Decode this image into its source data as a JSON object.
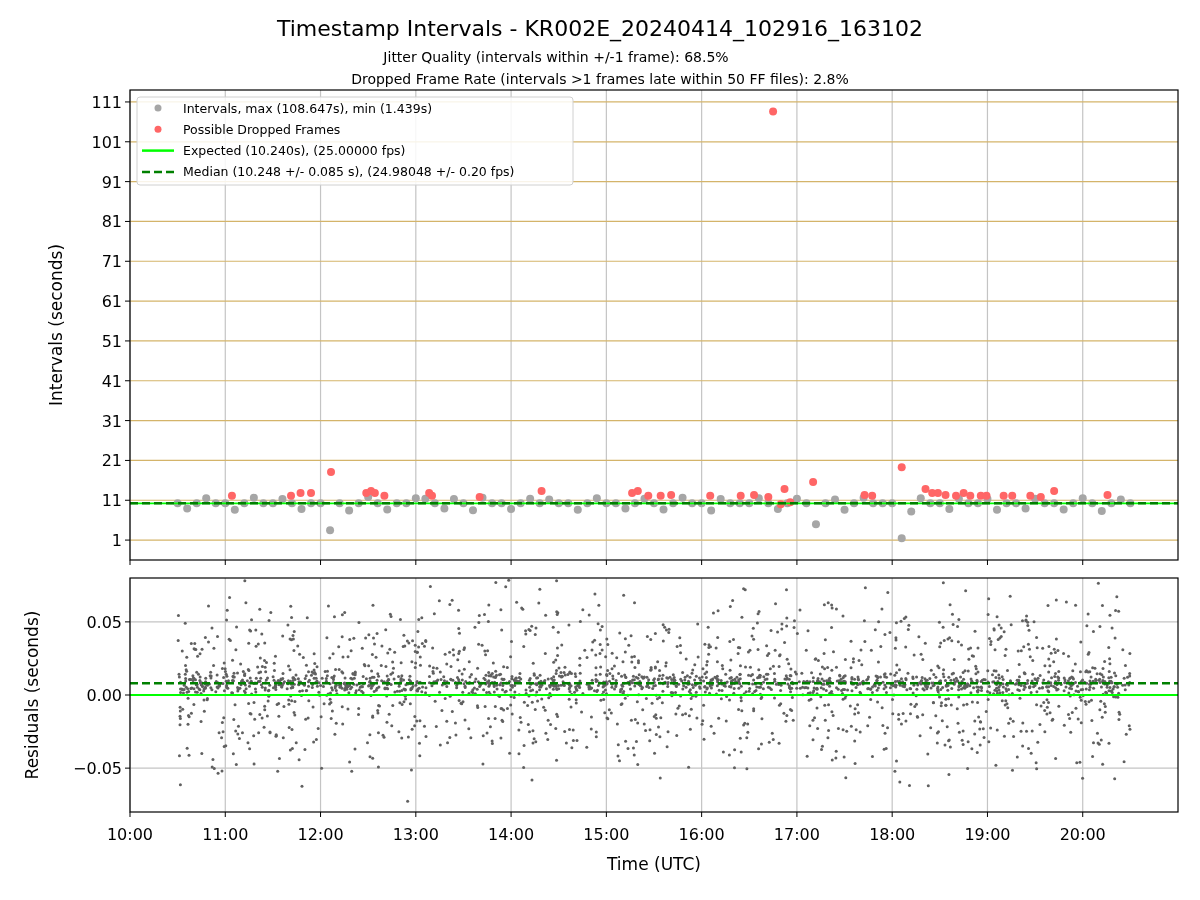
{
  "figure": {
    "title": "Timestamp Intervals - KR002E_20240414_102916_163102",
    "subtitles": [
      "Jitter Quality (intervals within +/-1 frame): 68.5%",
      "Dropped Frame Rate (intervals >1 frames late within 50 FF files): 2.8%"
    ]
  },
  "charts": [
    {
      "chart_data": {
        "type": "scatter",
        "ylabel": "Intervals (seconds)",
        "xlim": [
          10,
          21
        ],
        "ylim": [
          -4,
          114
        ],
        "yticks": [
          1,
          11,
          21,
          31,
          41,
          51,
          61,
          71,
          81,
          91,
          101,
          111
        ],
        "grid": true,
        "legend": "upper left",
        "series": [
          {
            "name": "Intervals, max (108.647s), min (1.439s)",
            "color": "#a6a6a6",
            "x": [
              10.5,
              10.6,
              10.7,
              10.8,
              10.9,
              11.0,
              11.1,
              11.2,
              11.3,
              11.4,
              11.5,
              11.6,
              11.7,
              11.8,
              11.9,
              12.0,
              12.1,
              12.2,
              12.3,
              12.4,
              12.5,
              12.6,
              12.7,
              12.8,
              12.9,
              13.0,
              13.1,
              13.2,
              13.3,
              13.4,
              13.5,
              13.6,
              13.7,
              13.8,
              13.9,
              14.0,
              14.1,
              14.2,
              14.3,
              14.4,
              14.5,
              14.6,
              14.7,
              14.8,
              14.9,
              15.0,
              15.1,
              15.2,
              15.3,
              15.4,
              15.5,
              15.6,
              15.7,
              15.8,
              15.9,
              16.0,
              16.1,
              16.2,
              16.3,
              16.4,
              16.5,
              16.6,
              16.7,
              16.8,
              16.9,
              17.0,
              17.1,
              17.2,
              17.3,
              17.4,
              17.5,
              17.6,
              17.7,
              17.8,
              17.9,
              18.0,
              18.1,
              18.2,
              18.3,
              18.4,
              18.5,
              18.6,
              18.7,
              18.8,
              18.9,
              19.0,
              19.1,
              19.2,
              19.3,
              19.4,
              19.5,
              19.6,
              19.7,
              19.8,
              19.9,
              20.0,
              20.1,
              20.2,
              20.3,
              20.4,
              20.5
            ],
            "values": [
              10.24,
              8.9,
              10.24,
              11.5,
              10.24,
              10.24,
              8.6,
              10.24,
              11.6,
              10.24,
              10.24,
              11.3,
              10.24,
              8.8,
              10.24,
              10.24,
              3.5,
              10.24,
              8.4,
              10.24,
              11.8,
              10.24,
              8.7,
              10.24,
              10.24,
              11.5,
              11.4,
              10.24,
              8.9,
              11.3,
              10.24,
              8.5,
              11.6,
              10.24,
              10.24,
              8.8,
              10.24,
              11.4,
              10.24,
              11.2,
              10.24,
              10.24,
              8.6,
              10.24,
              11.5,
              10.24,
              10.24,
              8.9,
              10.24,
              11.4,
              10.24,
              8.7,
              10.24,
              11.6,
              10.24,
              10.24,
              8.4,
              11.3,
              10.24,
              10.24,
              10.24,
              11.5,
              10.24,
              8.8,
              10.24,
              11.4,
              10.24,
              5.0,
              10.24,
              11.2,
              8.6,
              10.24,
              11.6,
              10.24,
              10.24,
              10.24,
              1.44,
              8.2,
              11.5,
              10.24,
              10.24,
              8.8,
              11.4,
              10.24,
              10.24,
              11.3,
              8.6,
              10.24,
              10.24,
              8.9,
              11.4,
              10.24,
              10.24,
              8.7,
              10.24,
              11.5,
              10.24,
              8.3,
              10.24,
              11.2,
              10.24
            ]
          },
          {
            "name": "Possible Dropped Frames",
            "color": "#ff6666",
            "x": [
              11.07,
              11.69,
              11.79,
              11.9,
              12.11,
              12.48,
              12.53,
              12.57,
              12.67,
              13.14,
              13.17,
              13.67,
              14.32,
              15.27,
              15.33,
              15.44,
              15.57,
              15.68,
              16.09,
              16.41,
              16.55,
              16.7,
              16.75,
              16.83,
              16.87,
              16.93,
              17.17,
              17.71,
              17.79,
              18.1,
              18.35,
              18.42,
              18.48,
              18.56,
              18.67,
              18.75,
              18.82,
              18.93,
              18.99,
              19.17,
              19.26,
              19.45,
              19.56,
              19.7,
              20.26
            ],
            "values": [
              12.1,
              12.1,
              12.8,
              12.8,
              18.1,
              12.8,
              13.3,
              12.8,
              12.1,
              12.8,
              12.1,
              11.8,
              13.3,
              12.8,
              13.3,
              12.1,
              12.1,
              12.3,
              12.1,
              12.1,
              12.3,
              11.8,
              108.6,
              10.0,
              13.8,
              10.5,
              15.6,
              12.3,
              12.1,
              19.3,
              13.8,
              12.8,
              12.8,
              12.3,
              12.1,
              12.8,
              12.1,
              12.1,
              12.1,
              12.1,
              12.1,
              12.1,
              11.8,
              13.3,
              12.3
            ]
          }
        ],
        "ref_lines": [
          {
            "axis": "y",
            "value": 10.24,
            "label": "Expected (10.240s), (25.00000 fps)",
            "color": "#00ff00"
          },
          {
            "axis": "y",
            "value": 10.248,
            "label": "Median (10.248 +/- 0.085 s), (24.98048 +/- 0.20 fps)",
            "color": "#008000"
          }
        ]
      }
    },
    {
      "chart_data": {
        "type": "scatter",
        "xlabel": "Time (UTC)",
        "ylabel": "Residuals (seconds)",
        "xlim": [
          10,
          21
        ],
        "ylim": [
          -0.08,
          0.08
        ],
        "grid": true,
        "xticks": [
          {
            "value": 10,
            "label": "10:00"
          },
          {
            "value": 11,
            "label": "11:00"
          },
          {
            "value": 12,
            "label": "12:00"
          },
          {
            "value": 13,
            "label": "13:00"
          },
          {
            "value": 14,
            "label": "14:00"
          },
          {
            "value": 15,
            "label": "15:00"
          },
          {
            "value": 16,
            "label": "16:00"
          },
          {
            "value": 17,
            "label": "17:00"
          },
          {
            "value": 18,
            "label": "18:00"
          },
          {
            "value": 19,
            "label": "19:00"
          },
          {
            "value": 20,
            "label": "20:00"
          }
        ],
        "yticks": [
          {
            "value": 0.05,
            "label": "0.05"
          },
          {
            "value": 0,
            "label": "0.00"
          },
          {
            "value": -0.05,
            "label": "−0.05"
          }
        ],
        "ref_lines": [
          {
            "axis": "y",
            "value": 0,
            "color": "#00ff00"
          },
          {
            "axis": "y",
            "value": 0.008,
            "color": "#008000"
          }
        ]
      }
    }
  ]
}
